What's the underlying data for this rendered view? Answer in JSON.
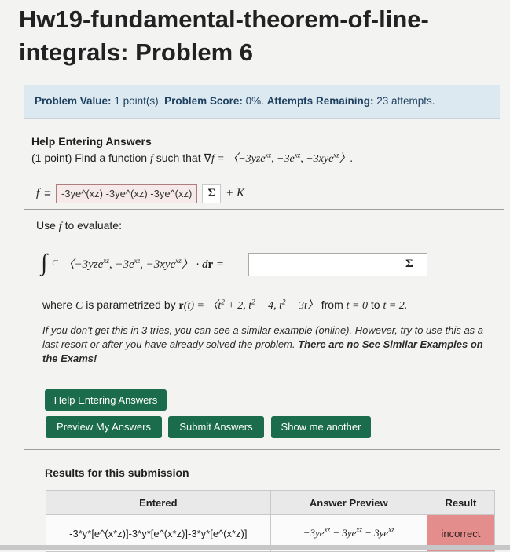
{
  "title": "Hw19-fundamental-theorem-of-line-integrals: Problem 6",
  "info": {
    "value_label": "Problem Value:",
    "value": "1 point(s).",
    "score_label": "Problem Score:",
    "score": "0%.",
    "attempts_label": "Attempts Remaining:",
    "attempts": "23 attempts."
  },
  "problem": {
    "help_heading": "Help Entering Answers",
    "points": "(1 point)",
    "prompt_start": "Find a function",
    "prompt_mid": "such that",
    "answer_value": "-3ye^(xz) -3ye^(xz) -3ye^(xz)",
    "plus_k": "+ K",
    "use_f_start": "Use",
    "use_f_end": "to evaluate:",
    "where_start": "where",
    "where_mid": "is parametrized by",
    "from_text": "from",
    "to_text": "to"
  },
  "note": {
    "text": "If you don't get this in 3 tries, you can see a similar example (online). However, try to use this as a last resort or after you have already solved the problem.",
    "bold": "There are no See Similar Examples on the Exams!"
  },
  "buttons": {
    "help": "Help Entering Answers",
    "preview": "Preview My Answers",
    "submit": "Submit Answers",
    "show_another": "Show me another"
  },
  "results": {
    "heading": "Results for this submission",
    "columns": [
      "Entered",
      "Answer Preview",
      "Result"
    ],
    "entered": "-3*y*[e^(x*z)]-3*y*[e^(x*z)]-3*y*[e^(x*z)]",
    "result": "incorrect"
  },
  "colors": {
    "button": "#1b6b4d",
    "info_bg": "#dde9f1",
    "incorrect_bg": "#e48d8d"
  }
}
